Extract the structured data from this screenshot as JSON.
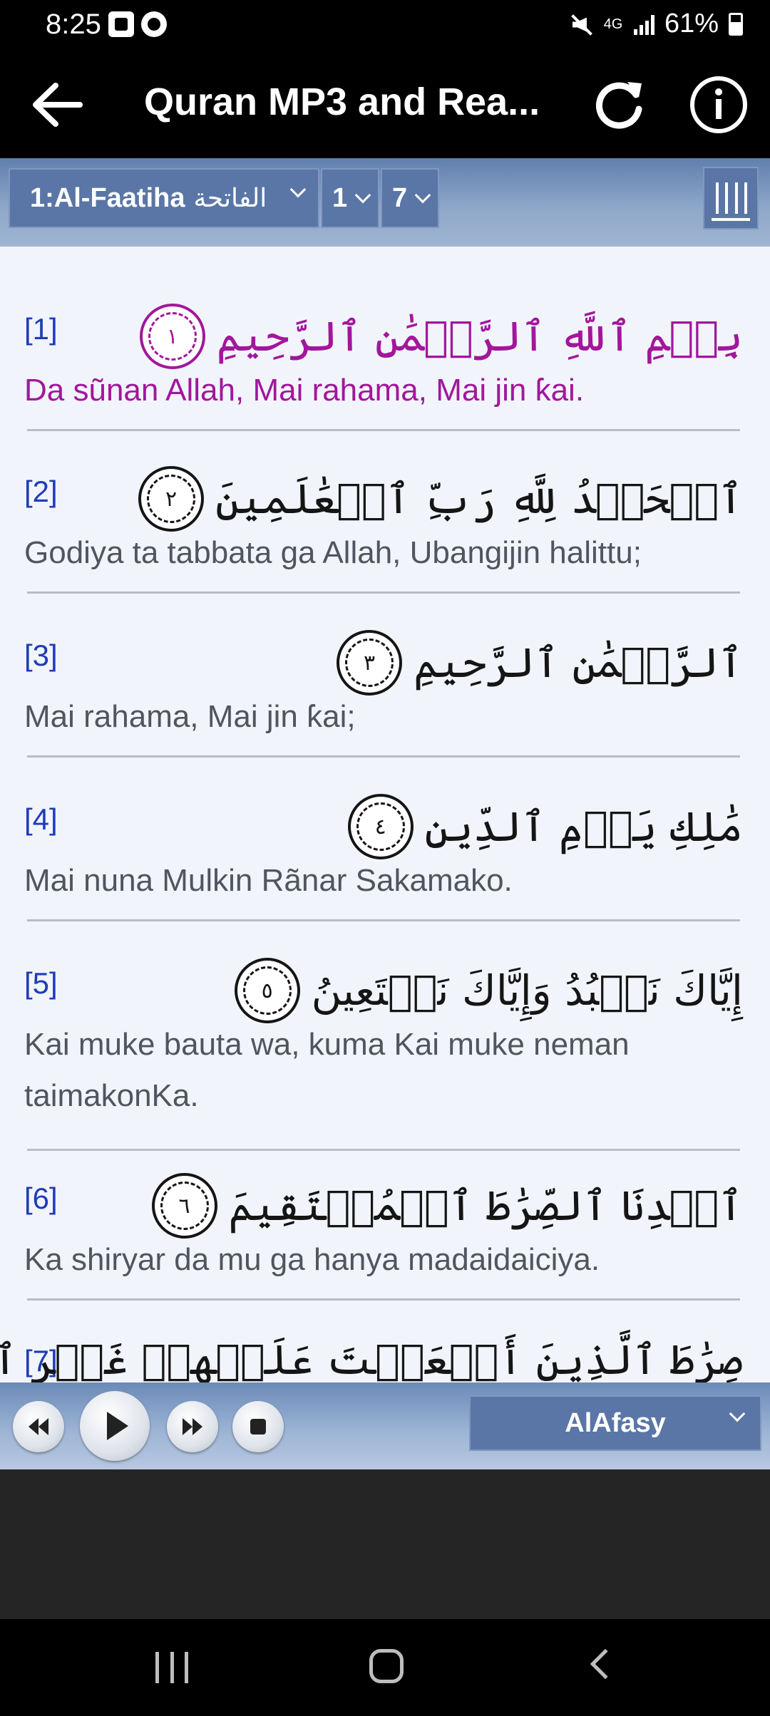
{
  "status_bar": {
    "time": "8:25",
    "network": "4G",
    "battery": "61%"
  },
  "app_bar": {
    "title": "Quran MP3 and Rea..."
  },
  "selector": {
    "surah_label": "1:Al-Faatiha",
    "surah_arabic": "الفاتحة",
    "ayah_from": "1",
    "ayah_to": "7"
  },
  "verses": [
    {
      "number": "[1]",
      "arabic": "بِسۡمِ ٱللَّهِ ٱلرَّحۡمَٰنِ ٱلرَّحِيمِ",
      "marker": "١",
      "translation": "Da sũnan Allah, Mai rahama, Mai jin ƙai."
    },
    {
      "number": "[2]",
      "arabic": "ٱلۡحَمۡدُ لِلَّهِ رَبِّ ٱلۡعَٰلَمِينَ",
      "marker": "٢",
      "translation": "Godiya ta tabbata ga Allah, Ubangijin halittu;"
    },
    {
      "number": "[3]",
      "arabic": "ٱلرَّحۡمَٰنِ ٱلرَّحِيمِ",
      "marker": "٣",
      "translation": "Mai rahama, Mai jin ƙai;"
    },
    {
      "number": "[4]",
      "arabic": "مَٰلِكِ يَوۡمِ ٱلدِّينِ",
      "marker": "٤",
      "translation": "Mai nuna Mulkin Rãnar Sakamako."
    },
    {
      "number": "[5]",
      "arabic": "إِيَّاكَ نَعۡبُدُ وَإِيَّاكَ نَسۡتَعِينُ",
      "marker": "٥",
      "translation_line1": "Kai muke bauta wa, kuma Kai muke neman",
      "translation_line2": "taimakonKa."
    },
    {
      "number": "[6]",
      "arabic": "ٱهۡدِنَا ٱلصِّرَٰطَ ٱلۡمُسۡتَقِيمَ",
      "marker": "٦",
      "translation": "Ka shiryar da mu ga hanya madaidaiciya."
    },
    {
      "number": "[7]",
      "arabic": "صِرَٰطَ ٱلَّذِينَ أَنۡعَمۡتَ عَلَيۡهِمۡ غَيۡرِ ٱلۡمَغۡضُوبِ"
    }
  ],
  "player": {
    "reciter": "AlAfasy"
  },
  "icons": {
    "back": "arrow-left-icon",
    "refresh": "refresh-icon",
    "info": "info-icon",
    "menu": "vertical-bars-icon",
    "rewind": "rewind-icon",
    "play": "play-icon",
    "fast_forward": "fast-forward-icon",
    "stop": "stop-icon"
  },
  "colors": {
    "highlight_verse": "#a3169c",
    "verse_number": "#1f3cb8",
    "toolbar_blue": "#5a76a6"
  }
}
